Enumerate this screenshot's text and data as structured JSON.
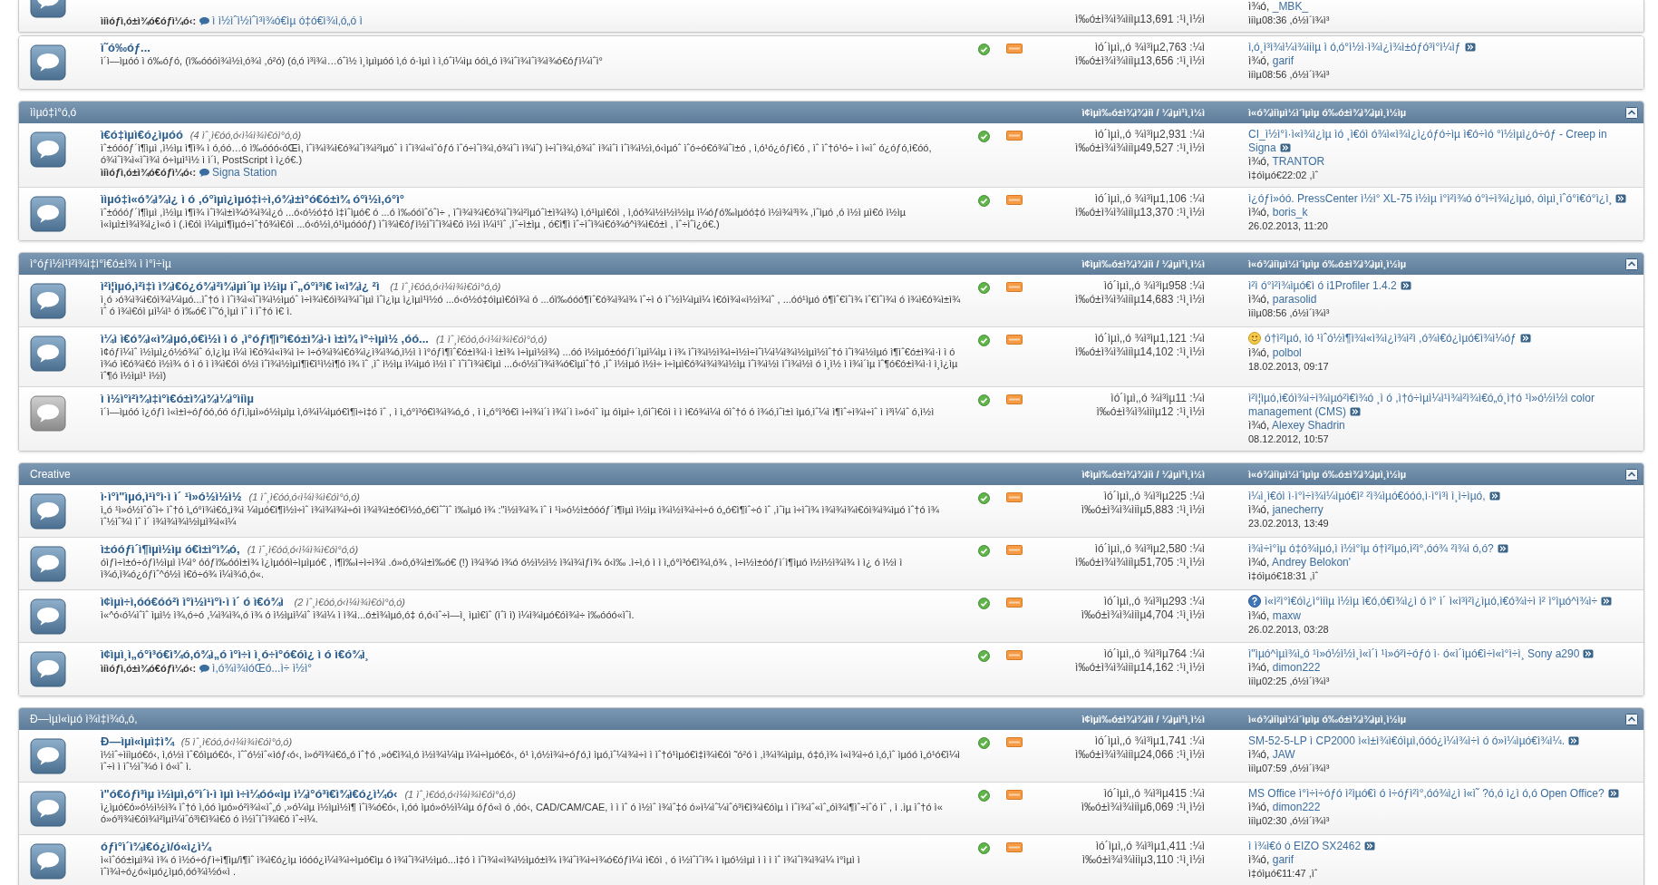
{
  "sections": [
    {
      "rows": [
        {
          "partial": true,
          "new_posts": true,
          "subforums": {
            "label": "ìiìóƒì‚ó±ì¾ó€óƒì¼ó‹:",
            "link": "ì ì½ìˆì½ìˆì³ì¾ó€ìµ ó‡ó€ì¾ì‚ó„ó ì"
          },
          "posts": "ì‰ó±ì¾ì¾ìiìµ13,691 :¹ì¸ì½ì",
          "last_post": {
            "by": "ì¾ó,",
            "author": "_MBK_",
            "date": "ìiìµ08:36 ,ó½ì´ì¾ì³"
          }
        }
      ]
    },
    {
      "rows": [
        {
          "partial": false,
          "new_posts": true,
          "title": "ì˜ó‰óƒ...",
          "description": "ì´ì—ìµóó ì ó‰óƒó, (ì‰óóóì¾ì½ì‚ó¾ì ,ó²ó) (ó‚ó ì³ì¾ì…óˆì½ ì¸ìµìµóó ì‚ó ó·ìµì ì ì‚óˆì¼ìµ óóì„ó ì¾ìˆì¾ìˆì¾ì¾ó€óƒì¼ìˆì°",
          "topics": "ìó´ìµì‚,ó ¾ì³ìµ2,763 :¼ì",
          "posts": "ì‰ó±ì¾ì¾ìiìµ13,656 :¹ì¸ì½ì",
          "last_post": {
            "kind": "text",
            "title": "ì‚ó¸ì³ì¾ì¼ì¾ìiìµ ì ó‚ó°ì½ì·ì¾ì¿ì¾ì±óƒó³ì°ì¼ìƒ",
            "by": "ì¾ó,",
            "author": "garif",
            "date": "ìiìµ08:56 ,ó½ì´ì¾ì³"
          }
        }
      ]
    },
    {
      "title": "ììµó‡ì°ó‚ó",
      "columns": [
        "ì¢ìµì‰ó±ì¾ì¾ìiì / ¼ìµì¹ì¸ì½ì",
        "ì«ó¾ìiìµì½ì´ìµìµ ó‰ó±ì¾ì¾ìµì¸ì½ìµ"
      ],
      "rows": [
        {
          "partial": false,
          "new_posts": true,
          "title": "ì€ó‡ìµì€ó¿ìµóó",
          "viewing": "(4 ìˆ¸ì€óó‚ó‹ì¼ì¾ì€óì°ó‚ó)",
          "description": "ìˆ±óóóƒ´ì¶ìµì ,ì½ìµ ì¶ì¾ ì ó‚óó…ó ì‰óóó‹óŒì, ìˆì¾ì¾ì€ó¾ìˆì¾ì²ìµóˆ ì ìˆì¾ì«ìˆóƒó ìˆó÷ìˆì¾ì,ó¾ìˆì ì¾ìˆ) ì÷ìˆì¾ì‚ó¾ìˆ ì¾ìˆì ìˆì¾ì½ì,ó‹ìµóˆ ìˆó÷ó€ó¾ìˆì±ó , ì‚ó¹ó¿óƒì€ó , ìˆ ìˆ†ó¹ó÷ ì ì«ìˆ ó¿óƒó‚ì€óó, ó¾ìˆì¾ì«ìˆì¾ì ó÷ìµì¹ì½ ì ì´ì, PostScript ì ì¿ó€.)",
          "subforums": {
            "label": "ìiìóƒì‚ó±ì¾ó€óƒì¼ó‹:",
            "link": "Signa Station"
          },
          "topics": "ìó´ìµì‚,ó ¾ì³ìµ2,931 :¼ì",
          "posts": "ì‰ó±ì¾ì¾ìiìµ49,527 :¹ì¸ì½ì",
          "last_post": {
            "kind": "text",
            "title": "CI_ì½ì°ì·ì«ì¾ì¿ìµ ìó ¸ì€óì ó¾ì«ì¾ì¿ì¿óƒó÷ìµ ì€ó÷ìó °ì½ìµì¿ó÷óƒ - Creep in Signa",
            "by": "ì¾ó,",
            "author": "TRANTOR",
            "date": "ì‡óìµó€22:02 ,ìˆ"
          }
        },
        {
          "partial": false,
          "new_posts": true,
          "title": "ììµó‡ì«ó¾ì¾ì¿ ì ó ,ó°ìµì¿ìµó‡ì÷ì‚ó¾ì±ì°ó€ó±ì¾ ó°ì½ì,ó°ì°",
          "description": "ìˆ±óóóƒ´ì¶ìµì ,ì½ìµ ì¶ì¾ ìˆì¾ì±ì¾ó¾ì¾ì¿ó ...ó‹ó½ó‡ó ì‡ìˆìµó€ ó ...ó ì‰óóìˆóˆì÷ , ìˆì¾ì¾ì€ó¾ìˆì¾ì²ìµóˆì±ì¾ì¾) ì‚ó¹ìµì€óì , ì‚óó¾ì½ì½ì½ìµ ì¼óƒó‰ìµóó‡ó ì½ì¾ì³ì¾ ,ìˆìµó ,ó ì½ì µì€ó ì½ìµ ì«ìµì±ì¾ì¾ì¿ì«ó ì (.ì€óì ì¼ìµì¶ìµó÷ìˆ†ó¾ì€óì ...ó‹ó½ì,ó¹ìµóóóƒ) ìˆì¾ì€óƒì½ìˆìˆì¾ì€ó ì½ì ì¼ì¹ìˆ ,ìˆ÷ì±ìµ , ó€ì¶ì ìˆ÷ìˆì¾ì€ó¾ó^ì¾ì€ó±ì , ìˆ÷ìˆì¿ó€.)",
          "topics": "ìó´ìµì‚,ó ¾ì³ìµ1,106 :¼ì",
          "posts": "ì‰ó±ì¾ì¾ìiìµ13,370 :¹ì¸ì½ì",
          "last_post": {
            "kind": "text",
            "title": "ì¿óƒì»óó. PressCenter ì½ì° XL-75 ì½ìµ ì°ì²ì¾ó ó°ì÷ì¾ì¿ìµó, óìµì¸ìˆó°ì€ó°ì¿ì¸",
            "by": "ì¾ó,",
            "author": "boris_k",
            "date": "26.02.2013, 11:20"
          }
        }
      ]
    },
    {
      "title": "ì°óƒì½ì¹ì²ì¾ì‡ì°ì€ó±ì¾ ì ì°ì÷ìµ",
      "columns": [
        "ì¢ìµì‰ó±ì¾ì¾ìiì / ¼ìµì¹ì¸ì½ì",
        "ì«ó¾ìiìµì½ì´ìµìµ ó‰ó±ì¾ì¾ìµì¸ì½ìµ"
      ],
      "rows": [
        {
          "partial": false,
          "new_posts": true,
          "title": "ì²ì¦ìµó,ì²ì‡ì ì¾ì€ó¿ó¾ì²ì¾ìµì´ìµ ì½ìµ ìˆ„ó°ì³ì€ ì«ì¾ì¿ ²ì ",
          "viewing": "(1 ìˆ¸ì€óó‚ó‹ì¼ì¾ì€óì°ó‚ó)",
          "description": "ì¸ó ›ó¾ì¾ì€óì¾ì¼ìµó...ìˆ†ó ì ìˆì¾ì«ìˆì¾ì½ìµóˆ ì÷ì¾ì€óì¾ì¾ìˆìµì ìˆì¿ìµ ì¿ìµì¹ì½ó ...ó‹ó½ó‡óìµì€óì¾ì ó ...óì‰óóó¶ìˆ€ó¾ì¾ì¾ ìˆ÷ì ó ìˆ½ì¼ìµì¼ ì€óì¾ì«ì½ì¾ìˆ , ...óó¹ìµó ó¶ìˆ€ìˆì¾ ìˆ€ìˆì¾ì ó ì¾ì€ó¾ì±ì¾ ìˆ ó ì¾ì€óì µì¼ì¹ ó ì‰ó€ ìˆ˜ó¸ìµì ìˆ ì ìˆ†ó ì€ ì.",
          "topics": "ìó´ìµì‚,ó ¾ì³ìµ958 :¼ì",
          "posts": "ì‰ó±ì¾ì¾ìiìµ14,683 :¹ì¸ì½ì",
          "last_post": {
            "kind": "text",
            "title": "ì²ì ó°ì²ì¾ìµó€ì ó i1Profiler 1.4.2",
            "by": "ì¾ó,",
            "author": "parasolid",
            "date": "ìiìµ08:56 ,ó½ì´ì¾ì³"
          }
        },
        {
          "partial": false,
          "new_posts": true,
          "title": "ì¼ì ì€ó¾ì«ì¾ìµó,ó€ì½ì ì ó ,ì°óƒì¶ì°ì€ó±ì¾ì·ì ì±ì¾ ì°÷ìµì½ ,óó...",
          "viewing": "(1 ìˆ¸ì€óó‚ó‹ì¼ì¾ì€óì°ó‚ó)",
          "description": "ì¢óƒì¼ìˆ ì½ìµì¿ó½ó¾ìˆ ó‚ì¿ìµ ì¼ì ì€ó¾ì«ì¾ì ì÷ ì÷ó¾ì¾ì€ó¾ì¿ì¾ì¾ó‚ì½ì ì ì°óƒì¶ìˆ€ó±ì¾ì·ì ì±ì¾ ì÷ìµì½ì¾) ...óó ì½ìµó±óóƒì´ìµì¼ìµ ì ì¾ ìˆì¾ì½ì¾ì÷ì½ì÷ìˆì¼ì¼ì¾ì½ìµì½ìˆ†ó ìˆì¾ì½ìµó ì¶ìˆ€ó±ì¾ì·ì ì ó ì¾ó ì€ó¾ì€ó ì½ì¾ ó ì ó ì ì¾ì€óì ó½ì ìˆì¾ì½ìµì¶ì€ì¹ì½ì¶ó ì¾ ìˆ ,ìˆ ì½ìµ ì¼ìµó ì½ì ìˆ ìˆìˆì¾ì€ìµì ...ó‹ó½ìˆì¾ì¾ó€ìµìˆ†ó ,ìˆ ì½ìµó ì½ì÷ ì÷ìµì€ó¾ì¾ì¾ì½ìµ ìˆì¾ì½ì ìˆì¾ì½ì ó ì¸ì½ ì ì¾ì´ìµ ìˆ¶ó€ó±ì¾ì·ì ì¸ì¿ìµ ìˆ¶ó ì½ìµì¹ ì½ì)",
          "topics": "ìó´ìµì‚,ó ¾ì³ìµ1,121 :¼ì",
          "posts": "ì‰ó±ì¾ì¾ìiìµ14,102 :¹ì¸ì½ì",
          "last_post": {
            "kind": "smiley",
            "title": "ó†ì²ìµó, ìó ¹ìˆó½ì¶ì¾ì«ì¾ì¿ì¾ì²ì ,ó¾ì€ó¿ìµó€ì¾ì¼óƒ",
            "by": "ì¾ó,",
            "author": "polbol",
            "date": "18.02.2013, 09:17"
          }
        },
        {
          "partial": false,
          "new_posts": false,
          "title": "ì ì½ì°ì²ì¾ì‡ì°ì€ó±ì¾ì¾ì¼ì°ìiìµ",
          "description": "ì´ì—ìµóó ì¿óƒì ì«ì±ì÷óƒóó,óó óƒì‚ìµì»ó½ìµìµ ì‚ó¾ì¼ìµó€ì¶ì÷ì‡ó ìˆ , ì ì„ó°ì³ó€ì¾ì¾ó„ó , ì ì„ó°ì³ó€ì ì÷ì¾ì´ì ì¾ì´ì ì»ó‹ìˆ ìµ óìµì÷ ì‚óìˆì€óì ì ì ì€ó¾ì¼ì óìˆ†ó ó ì¾ó‚ìˆì±ì ìµó‚ìˆ¼ì ì¶ìˆ÷ì¾ì÷ìˆ ì ì³ì¼ìˆ ó,ì½ì",
          "topics": "ìó´ìµì‚,ó ¾ì³ìµ11 :¼ì",
          "posts": "ì‰ó±ì¾ì¾ìiìµ12 :¹ì¸ì½ì",
          "last_post": {
            "kind": "text",
            "title": "ì²ì¦ìµó,ì€óì¾ì÷ì¾ìµó²ì€ì¾ó ¸ì ó ,ì†ó÷ìµì¼ì¹ì¾ì²ì¾ì€ó„ó¸ì†ó ¹ì»ó½ì½ì color management (CMS)",
            "by": "ì¾ó,",
            "author": "Alexey Shadrin",
            "date": "08.12.2012, 10:57"
          }
        }
      ]
    },
    {
      "title": "Creative",
      "columns": [
        "ì¢ìµì‰ó±ì¾ì¾ìiì / ¼ìµì¹ì¸ì½ì",
        "ì«ó¾ìiìµì½ì´ìµìµ ó‰ó±ì¾ì¾ìµì¸ì½ìµ"
      ],
      "rows": [
        {
          "partial": false,
          "new_posts": true,
          "title": "ì·ì°ì\"ìµó,ì¹ì°ì·ì ì´ ¹ì»ó½ì½ì½",
          "viewing": "(1 ìˆ¸ì€óó‚ó‹ì¼ì¾ì€óì°ó‚ó)",
          "description": "ì„ó ¹ì»ó½ìˆóˆì÷ ìˆ†ó ì„ó°ì¾ì€ó„ì¾ì ¼ìµó€ì¶ì½ì÷ìˆ ì¾ì¾ì¾ì÷óì ì¾ì¾ì±ó€ì½ó„ó€ìˆˆìˆ ì‰ìµó ì¾ :\"ì½ì¾ì¾ ìˆ ì ¹ì»ó½ì±óóóƒ´ì¶ìµì ì½ìµ ì¾ì½ì¾ì÷ì÷ó ó„ó€ì¶ìˆ÷ó ìˆ ,ìˆìµ ì÷ìˆì¾ ì¾ì¾ì¾ì€óì¾ì¾ìµó ìˆ†ó ì¾ ìˆ½ìˆ¾ì ìˆ ì´ ì¾ì¾ì¾ì½ìµì¾ì«ì¼",
          "topics": "ìó´ìµì‚,ó ¾ì³ìµ225 :¼ì",
          "posts": "ì‰ó±ì¾ì¾ìiìµ5,883 :¹ì¸ì½ì",
          "last_post": {
            "kind": "text",
            "title": "ì¼ì¸ì€óì ì·ì°ì÷ì¾ì¼ìµó€ì² ²ì¾ìµó€óóó,ì·ì°ì³ì ì¸ì÷ìµó,",
            "by": "ì¾ó,",
            "author": "janecherry",
            "date": "23.02.2013, 13:49"
          }
        },
        {
          "partial": false,
          "new_posts": true,
          "title": "ì±óóƒì´ì¶ìµì½ìµ ó€ì±ì°ì¾ó,",
          "viewing": "(1 ìˆ¸ì€óó‚ó‹ì¼ì¾ì€óì°ó‚ó)",
          "description": "óìƒì÷ì±ó÷óƒì½ìµì ì¼ì° óóƒì‰óóì±ì¾ ì¿ìµóóì÷ìµìµó€ , ì¶ì‰ì÷ì÷ì¾ì .ó»ó‚ó¾ì±ì‰ó€ (!) ì¾ì¾ó ì¾ó ó½ì½ì½ ì¾ì¾ìƒì¾ ó‹ì‰ .ì÷ì‚ó ì ì ì„ó°ì³ó€ì¾ì‚ó¾ , ì÷ì½ì±óóƒì´ì¶ìµó ì½ì½ì¾ì¾ ì ì¿ ó ì½ì ì ì¾ó‚ì¾ó¿óƒìˆ^ó½ì ì€ó÷ó¾ ì¼ì¾ó,ó«.",
          "topics": "ìó´ìµì‚,ó ¾ì³ìµ2,580 :¼ì",
          "posts": "ì‰ó±ì¾ì¾ìiìµ51,705 :¹ì¸ì½ì",
          "last_post": {
            "kind": "text",
            "title": "ì¾ì÷ì°ìµ ó‡ó¾ìµó,ì ì½ì°ìµ ó†ì²ìµó,ì²ì°,óó¾ ²ì¾ì ó,ó?",
            "by": "ì¾ó,",
            "author": "Andrey Belokon'",
            "date": "ì‡óìµó€18:31 ,ìˆ"
          }
        },
        {
          "partial": false,
          "new_posts": true,
          "title": "ì¢ìµì÷ì,óó€óó²ì ì°ì½ì¹ì°ì·ì ì´ ó ì€ó¾ì ",
          "viewing": "(2 ìˆ¸ì€óó‚ó‹ì¼ì¾ì€óì°ó‚ó)",
          "description": "ì«^ó‹ó¼ìˆìˆ ìµì½ ì¾,ó÷ó ,¼ì¾ì¾,ó ì¾ ó ì½ìµì¼ìˆ ì¾ì¼ ì ì¾ì...ó±ì¾ìµó,ó‡ ó,ó‹ìˆ÷ì—ì¸ ìµì€ìˆ (ìˆì ì) ì¼ì¾ìµó€óì¾ì÷ ì‰óóó«ìˆì.",
          "topics": "ìó´ìµì‚,ó ¾ì³ìµ293 :¼ì",
          "posts": "ì‰ó±ì¾ì¾ìiìµ4,704 :¹ì¸ì½ì",
          "last_post": {
            "kind": "question",
            "title": "ì«ì²ì°ì€óì¿ì°ìiìµ ì½ìµ ì€ó,ó€ì¾ì¿ì ó ì° ì´ ì«ì³ì²ì¿ìµó,ì€ó¾ì÷ì ì² ì°ìµó^ì¾ì÷",
            "by": "ì¾ó,",
            "author": "maxw",
            "date": "26.02.2013, 03:28"
          }
        },
        {
          "partial": false,
          "new_posts": true,
          "title": "ì¢ìµì¸ì„ó°ì³ó€ì¾ó,ó¾ì„ó ì°ì÷ì ì¸ó÷ì°ó€óì¿ ì ó ì€ó¾ì¸",
          "subforums": {
            "label": "ìiìóƒì‚ó±ì¾ó€óƒì¼ó‹:",
            "link": "ì,ó¾ì¾ìóŒó...ì÷ ì½ì°"
          },
          "topics": "ìó´ìµì‚,ó ¾ì³ìµ764 :¼ì",
          "posts": "ì‰ó±ì¾ì¾ìiìµ14,162 :¹ì¸ì½ì",
          "last_post": {
            "kind": "text",
            "title": "ì\"ìµó^ìµì¾ì„ó ¹ì»ó½ì½ì¸ì«ì´ì ¹ì»ó²ì÷óƒó ì· ó«ì´ìµó€ì÷ì«ì°ì÷ì¸ Sony a290",
            "by": "ì¾ó,",
            "author": "dimon222",
            "date": "ìiìµ02:25 ,ó½ì´ì¾ì³"
          }
        }
      ]
    },
    {
      "title": "Ð—ìµì«ìµó ì¾ì‡ì¾ó„ó,",
      "columns": [
        "ì¢ìµì‰ó±ì¾ì¾ìiì / ¼ìµì¹ì¸ì½ì",
        "ì«ó¾ìiìµì½ì´ìµìµ ó‰ó±ì¾ì¾ìµì¸ì½ìµ"
      ],
      "rows": [
        {
          "partial": false,
          "new_posts": true,
          "title": "Ð—ìµì«ìµì‡ì¾",
          "viewing": "(5 ìˆ¸ì€óó‚ó‹ì¼ì¾ì€óì°ó‚ó)",
          "description": "ì½ìˆ÷ìiìµó€ó‹, ì‚ó½ì ìˆ€óìµó€ó‹, ìˆˆó½ìˆ«ìóƒ‹ó‹, ì»ó²ì¾ì€ó„ó ìˆ†ó ,»ó€ì¾ì‚ó ì½ì¾ì¼ìµ ì¼ì÷ìµó€ó‹, ó¹ ì‚ó½ì¾ì÷óƒó‚ì ìµó‚ìˆ¼ì¾ì÷ì  ì ìˆ†ó¹ìµó€ì‡ì¾ì€óì ˜ó²ó ì ,ì¾ì¾ìµìµ, ó‡ó‚ì¾ ì«ì¾ì÷ó ì‚ó‚ìˆ ìµóó ì„ó¹ó€ì¼ì ìˆ÷ì ì ìˆ½ìˆ¾ó ì ó«ìˆ ì.",
          "topics": "ìó´ìµì‚,ó ¾ì³ìµ1,741 :¼ì",
          "posts": "ì‰ó±ì¾ì¾ìiìµ24,066 :¹ì¸ì½ì",
          "last_post": {
            "kind": "text",
            "title": "SM-52-5-LP ì CP2000 ì«ì±ì¾ì€óìµì,óóó¿ì¼ì¾ì÷ì ó ó»ì¼ìµó€ì¾ì¼.",
            "by": "ì¾ó,",
            "author": "JAW",
            "date": "ìiìµ07:59 ,ó½ì´ì¾ì³"
          }
        },
        {
          "partial": false,
          "new_posts": true,
          "title": "ì\"ó€óƒì³ìµ ì½ìµì,ó°ì´ì·ì ìµì ì÷ì¼óó«ìµ ì¼ì°ó³ì€ì¾ì€ó¿ì¼ó‹",
          "viewing": "(1 ìˆ¸ì€óó‚ó‹ì¼ì¾ì€óì°ó‚ó)",
          "description": "ì¿ìµó€ó»ó½ì½ì¾ ìˆ†ó ì,óó ìµó»ó²ì¾ì«ìˆ„ó ,»ó¼ìµ ì½ìµì½ì¶ ìˆì¾ó€ó‹, ì,óó ìµó»ó½ì¼ìµ óƒó«ì ó ,óó‹, CAD/CAM/CAE, ì ì ìˆ ó ì½ìˆ ì¾ìˆ‡ó ó»ì¼ìˆ¼ìˆó³ì€ì¾ì€óìµ ì ìˆì¾ìˆ«ìˆ„óì¾ì¶ìˆ÷ìˆó ìˆ , ì .ìµ ìˆ†ó ì« ó»ó³ì¾ì€óì¾ì²ìµì¼ìˆó³ì€ì¾ì€ó ó ì½ìˆìˆì¾ì€ó ìˆ÷ì¼.",
          "topics": "ìó´ìµì‚,ó ¾ì³ìµ415 :¼ì",
          "posts": "ì‰ó±ì¾ì¾ìiìµ6,069 :¹ì¸ì½ì",
          "last_post": {
            "kind": "text",
            "title": "MS Office ì°ì÷ì÷óƒó ì²ìµó€ì ó ì÷óƒì²ì°,óó¾ì¿ì ì«ì˜ ?ó,ó ì¿ì ó,ó Open Office?",
            "by": "ì¾ó,",
            "author": "dimon222",
            "date": "ìiìµ02:30 ,ó½ì´ì¾ì³"
          }
        },
        {
          "partial": false,
          "new_posts": true,
          "title": "óƒì°ì´ì¾ì€ó¿ì/ó«ì¿ì¼",
          "description": "ì«ìˆóó±ìµì¾ì ì¾ ó ì½ó÷óƒì÷ì¶ìµ/ì¶ìˆ ì¾ì€ó¿ìµ ìóóó¿ì¼ì¾ì÷ìµó€ìµ ó ì¾ìˆì¾ì½ìµó...ì‡ó ì ìˆì¾ì«ì¾ì½ìµó±ì¾ ì¾ìˆì¾ì÷ì¾ó€óƒì¼ì ì€óì , ó ì½ìˆìˆì¾ ì ìµó½ìµì ì ì ì ìˆ ì¾ìˆì¾ì¾ì¼ ì°ìµì ì ìˆì¾ì÷ó¿ó«ìµó¿ìµó,óó¾ì½ó«ì .",
          "topics": "ìó´ìµì‚,ó ¾ì³ìµ1,411 :¼ì",
          "posts": "ì‰ó±ì¾ì¾ìiìµ3,110 :¹ì¸ì½ì",
          "last_post": {
            "kind": "text",
            "title": "ì ì¾ì€ó ó EIZO SX2462",
            "by": "ì¾ó,",
            "author": "garif",
            "date": "ì‡óìµó€11:47 ,ìˆ"
          }
        }
      ]
    }
  ]
}
